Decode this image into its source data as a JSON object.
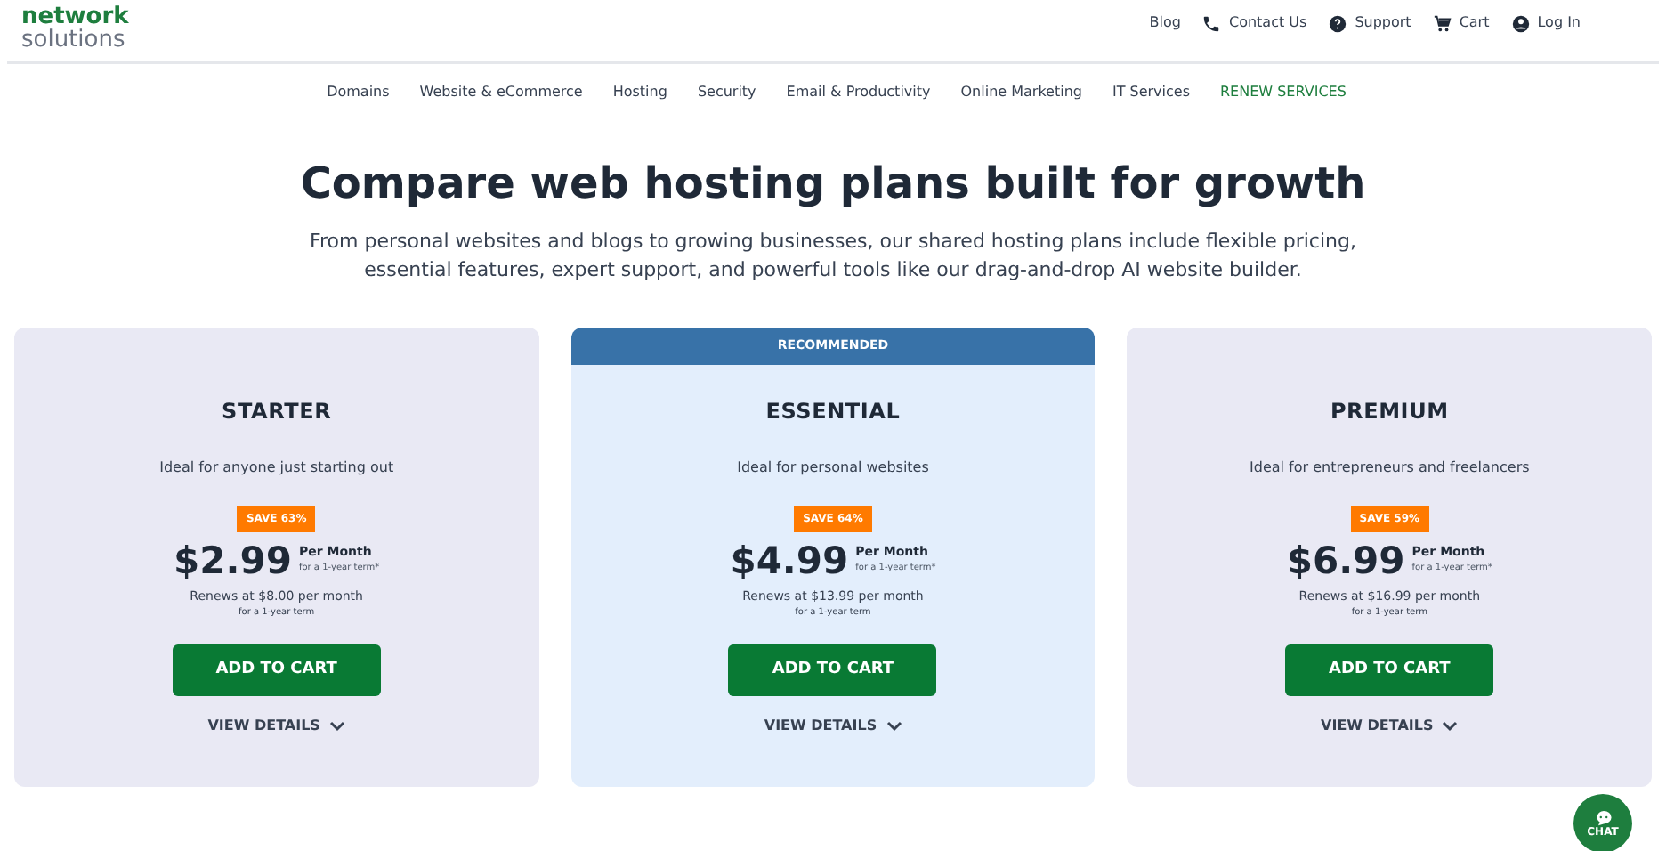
{
  "logo": {
    "line_1": "network",
    "line_2": "solutions"
  },
  "top_links": [
    {
      "label": "Blog"
    },
    {
      "label": "Contact Us"
    },
    {
      "label": "Support"
    },
    {
      "label": "Cart"
    },
    {
      "label": "Log In"
    }
  ],
  "nav": [
    {
      "label": "Domains",
      "selected": false
    },
    {
      "label": "Website & eCommerce",
      "selected": false
    },
    {
      "label": "Hosting",
      "selected": false
    },
    {
      "label": "Security",
      "selected": false
    },
    {
      "label": "Email & Productivity",
      "selected": false
    },
    {
      "label": "Online Marketing",
      "selected": false
    },
    {
      "label": "IT Services",
      "selected": false
    },
    {
      "label": "RENEW SERVICES",
      "selected": true
    }
  ],
  "heading": "Compare web hosting plans built for growth",
  "subtitle": "From personal websites and blogs to growing businesses, our shared hosting plans include flexible pricing, essential features, expert support, and powerful tools like our drag-and-drop AI website builder.",
  "plans": [
    {
      "name": "STARTER",
      "tagline": "Ideal for anyone just starting out",
      "badge": "SAVE 63%",
      "price": "$2.99",
      "per": "Per Month",
      "term": "for a 1-year term*",
      "renews": "Renews at $8.00 per month",
      "renew_term": "for a 1-year term",
      "button": "ADD TO CART",
      "details": "VIEW DETAILS"
    },
    {
      "name": "ESSENTIAL",
      "banner": "RECOMMENDED",
      "tagline": "Ideal for personal websites",
      "badge": "SAVE 64%",
      "price": "$4.99",
      "per": "Per Month",
      "term": "for a 1-year term*",
      "renews": "Renews at $13.99 per month",
      "renew_term": "for a 1-year term",
      "button": "ADD TO CART",
      "details": "VIEW DETAILS"
    },
    {
      "name": "PREMIUM",
      "tagline": "Ideal for entrepreneurs and freelancers",
      "badge": "SAVE 59%",
      "price": "$6.99",
      "per": "Per Month",
      "term": "for a 1-year term*",
      "renews": "Renews at $16.99 per month",
      "renew_term": "for a 1-year term",
      "button": "ADD TO CART",
      "details": "VIEW DETAILS"
    }
  ],
  "chat": {
    "label": "CHAT"
  }
}
